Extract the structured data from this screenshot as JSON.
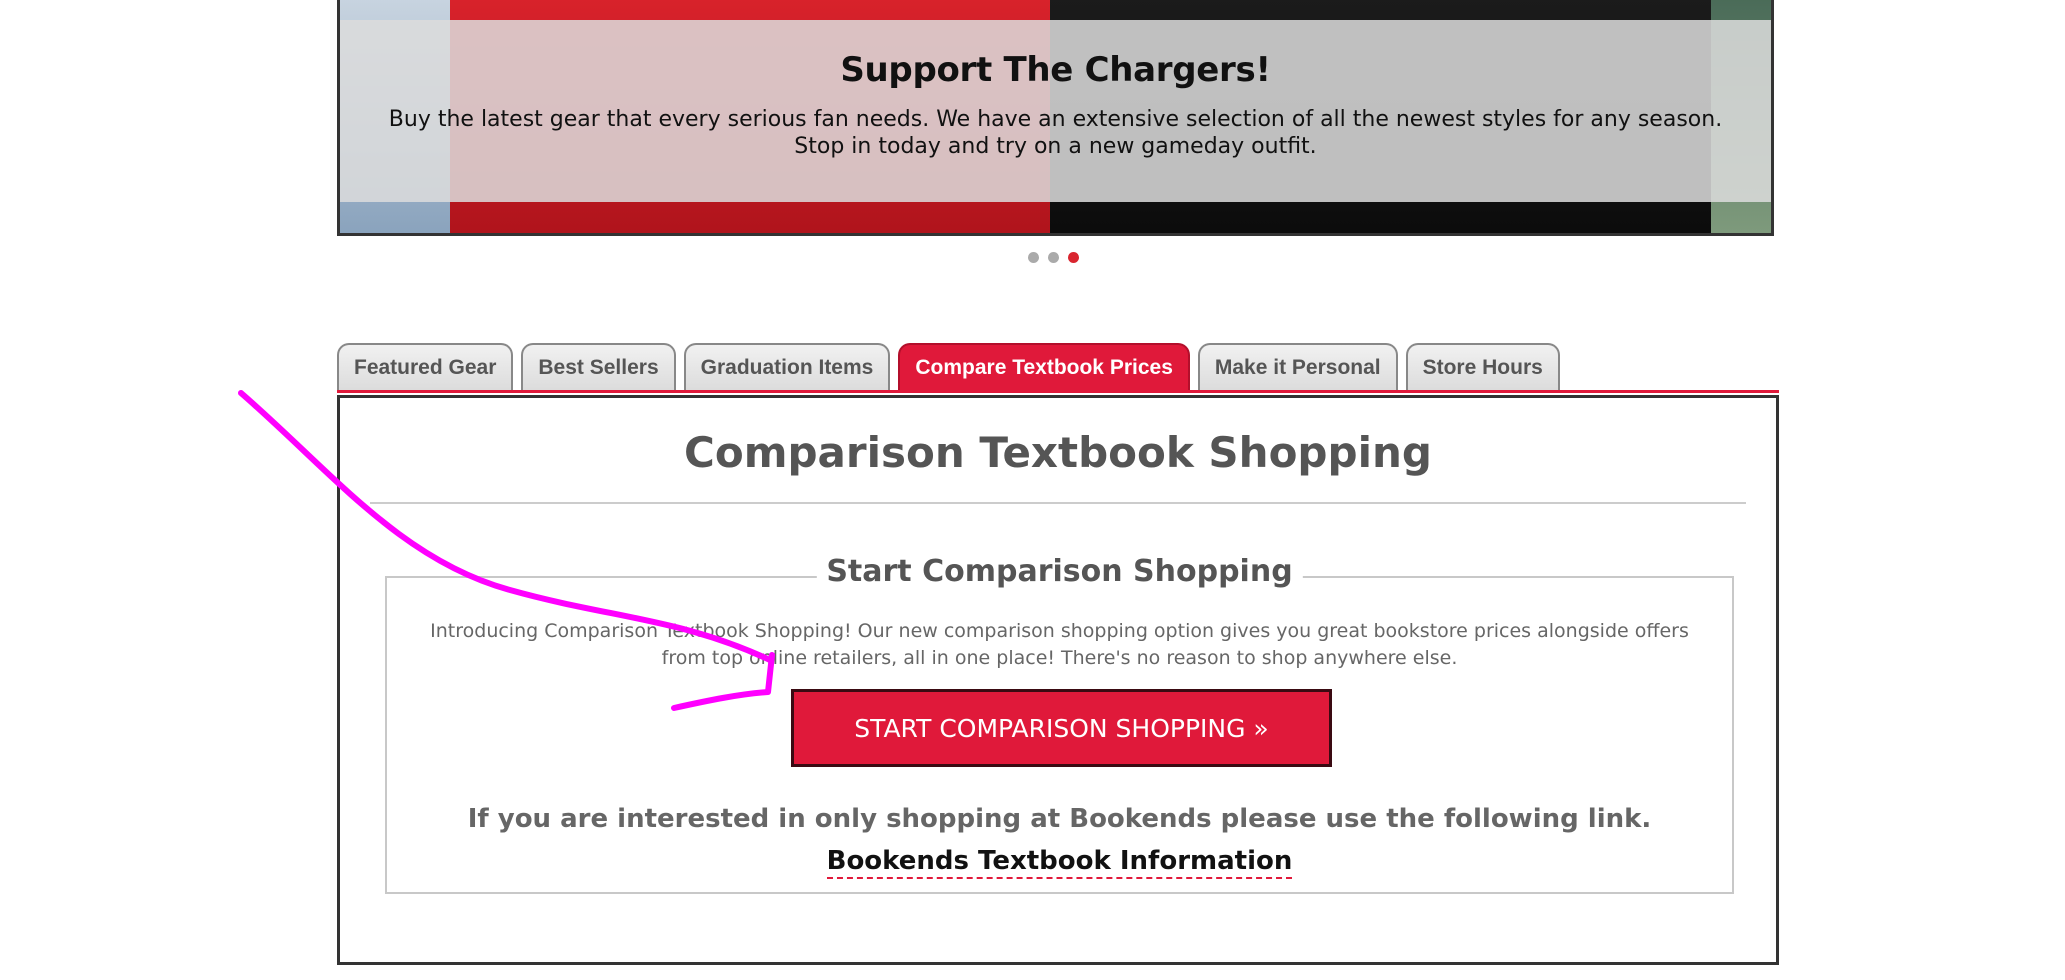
{
  "hero": {
    "title": "Support The Chargers!",
    "text": "Buy the latest gear that every serious fan needs. We have an extensive selection of all the newest styles for any season. Stop in today and try on a new gameday outfit.",
    "dots_total": 3,
    "active_dot": 3
  },
  "tabs": [
    {
      "label": "Featured Gear",
      "active": false
    },
    {
      "label": "Best Sellers",
      "active": false
    },
    {
      "label": "Graduation Items",
      "active": false
    },
    {
      "label": "Compare Textbook Prices",
      "active": true
    },
    {
      "label": "Make it Personal",
      "active": false
    },
    {
      "label": "Store Hours",
      "active": false
    }
  ],
  "panel": {
    "title": "Comparison Textbook Shopping",
    "legend": "Start Comparison Shopping",
    "intro": "Introducing Comparison Textbook Shopping! Our new comparison shopping option gives you great bookstore prices alongside offers from top online retailers, all in one place! There's no reason to shop anywhere else.",
    "cta_label": "START COMPARISON SHOPPING »",
    "note": "If you are interested in only shopping at Bookends please use the following link.",
    "link_label": "Bookends Textbook Information"
  },
  "colors": {
    "accent": "#e0193a",
    "annotation": "#ff00ff",
    "text_gray": "#555555"
  }
}
